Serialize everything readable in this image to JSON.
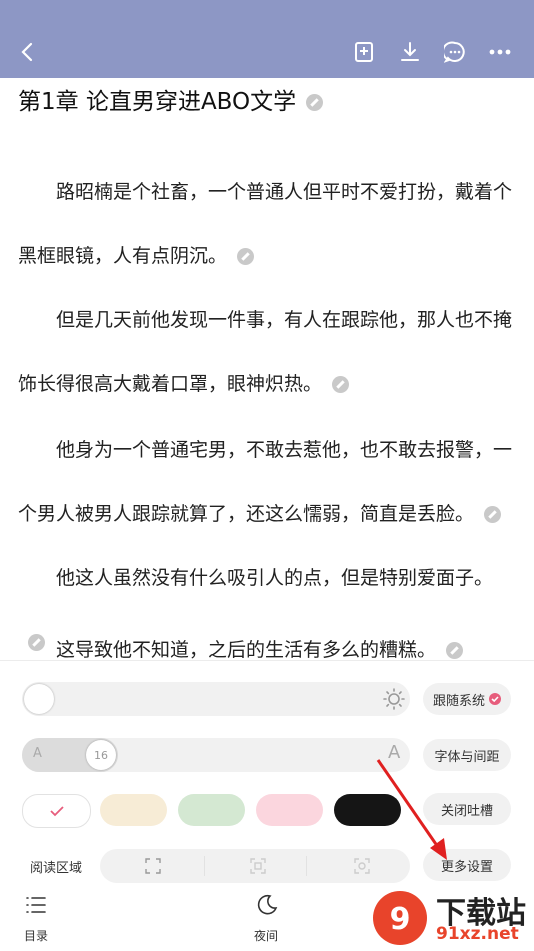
{
  "chapter": {
    "title": "第1章 论直男穿进ABO文学"
  },
  "paragraphs": [
    "路昭楠是个社畜，一个普通人但平时不爱打扮，戴着个黑框眼镜，人有点阴沉。",
    "但是几天前他发现一件事，有人在跟踪他，那人也不掩饰长得很高大戴着口罩，眼神炽热。",
    "他身为一个普通宅男，不敢去惹他，也不敢去报警，一个男人被男人跟踪就算了，还这么懦弱，简直是丢脸。",
    "他这人虽然没有什么吸引人的点，但是特别爱面子。",
    "这导致他不知道，之后的生活有多么的糟糕。"
  ],
  "settings": {
    "follow_system_label": "跟随系统",
    "font_size_value": "16",
    "font_small_glyph": "A",
    "font_large_glyph": "A",
    "font_spacing_label": "字体与间距",
    "close_comments_label": "关闭吐槽",
    "reading_area_label": "阅读区域",
    "more_settings_label": "更多设置"
  },
  "themes": [
    "#ffffff",
    "#f7ecd6",
    "#d4e8d2",
    "#fbd6de",
    "#151515"
  ],
  "nav": {
    "toc_label": "目录",
    "night_label": "夜间"
  },
  "watermark": {
    "text": "下载站",
    "url": "91xz.net"
  },
  "colors": {
    "topbar": "#8d97c5",
    "accent": "#e75d7c"
  }
}
